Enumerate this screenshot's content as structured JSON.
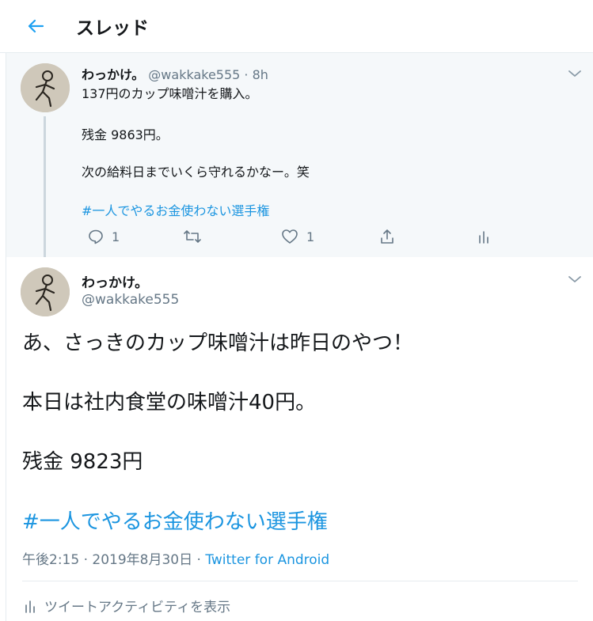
{
  "header": {
    "title": "スレッド",
    "back_icon": "arrow-left-icon",
    "accent": "#1da1f2"
  },
  "parent_tweet": {
    "name": "わっかけ。",
    "handle": "@wakkake555",
    "separator": "·",
    "time": "8h",
    "lines": [
      "137円のカップ味噌汁を購入。",
      "残金 9863円。",
      "次の給料日までいくら守れるかなー。笑"
    ],
    "hashtag": "#一人でやるお金使わない選手権",
    "actions": {
      "reply_count": "1",
      "retweet_count": "",
      "like_count": "1"
    }
  },
  "main_tweet": {
    "name": "わっかけ。",
    "handle": "@wakkake555",
    "lines": [
      "あ、さっきのカップ味噌汁は昨日のやつ！",
      "本日は社内食堂の味噌汁40円。",
      "残金 9823円"
    ],
    "hashtag": "#一人でやるお金使わない選手権",
    "timestamp": "午後2:15 · 2019年8月30日 ·",
    "source": "Twitter for Android",
    "activity_label": "ツイートアクティビティを表示"
  },
  "colors": {
    "link": "#1b95e0",
    "muted": "#657786",
    "text": "#14171a",
    "parent_bg": "#f5f8fa"
  }
}
